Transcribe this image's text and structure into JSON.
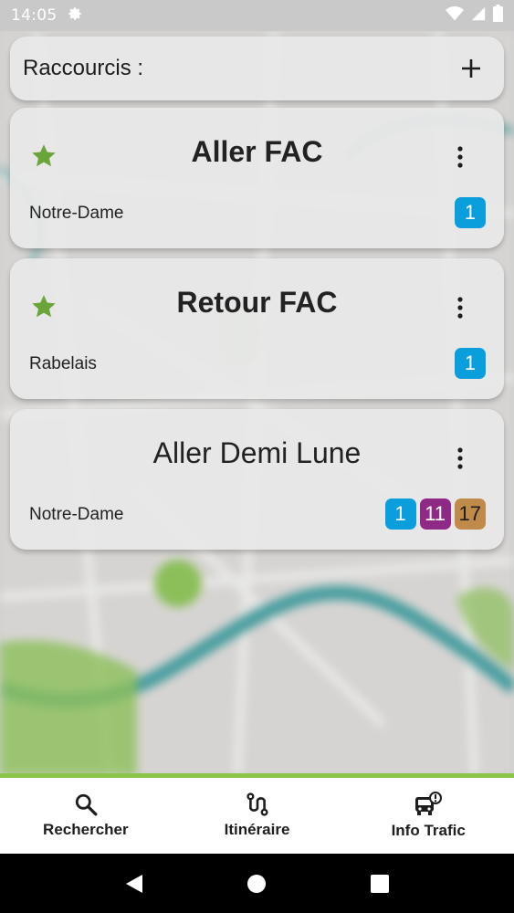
{
  "status_bar": {
    "time": "14:05",
    "icons": [
      "gear-icon",
      "wifi-icon",
      "signal-icon",
      "battery-icon"
    ]
  },
  "shortcuts_header": {
    "title": "Raccourcis :",
    "add_icon": "plus-icon"
  },
  "shortcuts": [
    {
      "name": "Aller FAC",
      "favorite": true,
      "stop": "Notre-Dame",
      "lines": [
        {
          "label": "1",
          "color": "#0a9fdc",
          "text_color": "#ffffff"
        }
      ]
    },
    {
      "name": "Retour FAC",
      "favorite": true,
      "stop": "Rabelais",
      "lines": [
        {
          "label": "1",
          "color": "#0a9fdc",
          "text_color": "#ffffff"
        }
      ]
    },
    {
      "name": "Aller Demi Lune",
      "favorite": false,
      "stop": "Notre-Dame",
      "lines": [
        {
          "label": "1",
          "color": "#0a9fdc",
          "text_color": "#ffffff"
        },
        {
          "label": "11",
          "color": "#8e2a85",
          "text_color": "#ffffff"
        },
        {
          "label": "17",
          "color": "#c08a4a",
          "text_color": "#1d1d1d"
        }
      ]
    }
  ],
  "bottom_nav": {
    "items": [
      {
        "label": "Rechercher",
        "icon": "search-icon"
      },
      {
        "label": "Itinéraire",
        "icon": "route-icon"
      },
      {
        "label": "Info Trafic",
        "icon": "bus-alert-icon"
      }
    ]
  },
  "colors": {
    "accent_green": "#8ac54a",
    "star_green": "#6aa53a",
    "map_river": "#4a9ea0"
  },
  "system_nav": {
    "icons": [
      "back-icon",
      "home-icon",
      "recents-icon"
    ]
  }
}
